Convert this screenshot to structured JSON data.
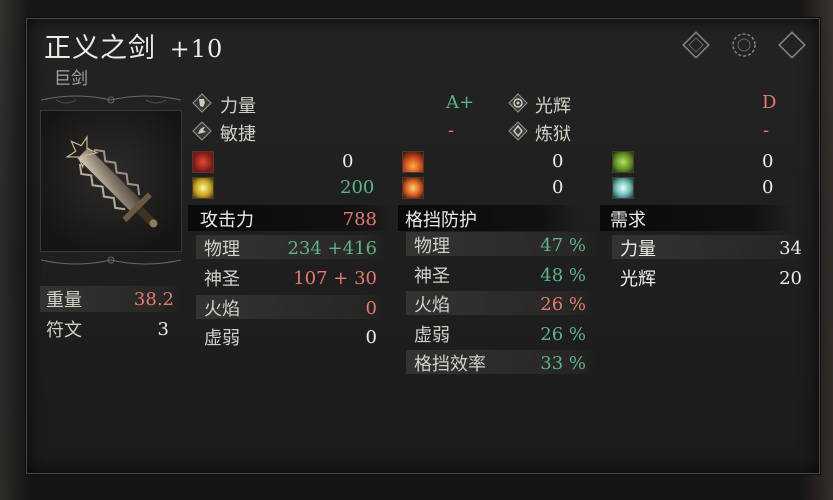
{
  "item": {
    "name": "正义之剑",
    "level": "+10",
    "type": "巨剑"
  },
  "scaling": [
    {
      "label": "力量",
      "grade": "A+",
      "icon": "strength-icon"
    },
    {
      "label": "敏捷",
      "grade": "-",
      "icon": "dexterity-icon"
    },
    {
      "label": "光辉",
      "grade": "D",
      "icon": "faith-icon"
    },
    {
      "label": "炼狱",
      "grade": "-",
      "icon": "arcane-icon"
    }
  ],
  "damage_icons": {
    "col1": [
      {
        "icon": "bleed-icon",
        "value": "0",
        "color": "#c0392b"
      },
      {
        "icon": "holy-icon",
        "value": "200",
        "color": "#e8e05a"
      }
    ],
    "col2": [
      {
        "icon": "fire-icon",
        "value": "0",
        "color": "#e0651f"
      },
      {
        "icon": "fire-burst-icon",
        "value": "0",
        "color": "#e07a2a"
      }
    ],
    "col3": [
      {
        "icon": "poison-icon",
        "value": "0",
        "color": "#7fb03a"
      },
      {
        "icon": "frost-icon",
        "value": "0",
        "color": "#a0d8d0"
      }
    ]
  },
  "weight": {
    "label": "重量",
    "value": "38.2"
  },
  "runes": {
    "label": "符文",
    "value": "3"
  },
  "attack": {
    "header": "攻击力",
    "total": "788",
    "rows": [
      {
        "label": "物理",
        "value": "234 +416"
      },
      {
        "label": "神圣",
        "value": "107 + 30"
      },
      {
        "label": "火焰",
        "value": "0"
      },
      {
        "label": "虚弱",
        "value": "0"
      }
    ]
  },
  "guard": {
    "header": "格挡防护",
    "rows": [
      {
        "label": "物理",
        "value": "47 %"
      },
      {
        "label": "神圣",
        "value": "48 %"
      },
      {
        "label": "火焰",
        "value": "26 %"
      },
      {
        "label": "虚弱",
        "value": "26 %"
      },
      {
        "label": "格挡效率",
        "value": "33 %"
      }
    ]
  },
  "requirements": {
    "header": "需求",
    "rows": [
      {
        "label": "力量",
        "value": "34"
      },
      {
        "label": "光辉",
        "value": "20"
      }
    ]
  },
  "colors": {
    "green": "#5fb38a",
    "red": "#e67a6f",
    "text": "#d4d0c8"
  }
}
